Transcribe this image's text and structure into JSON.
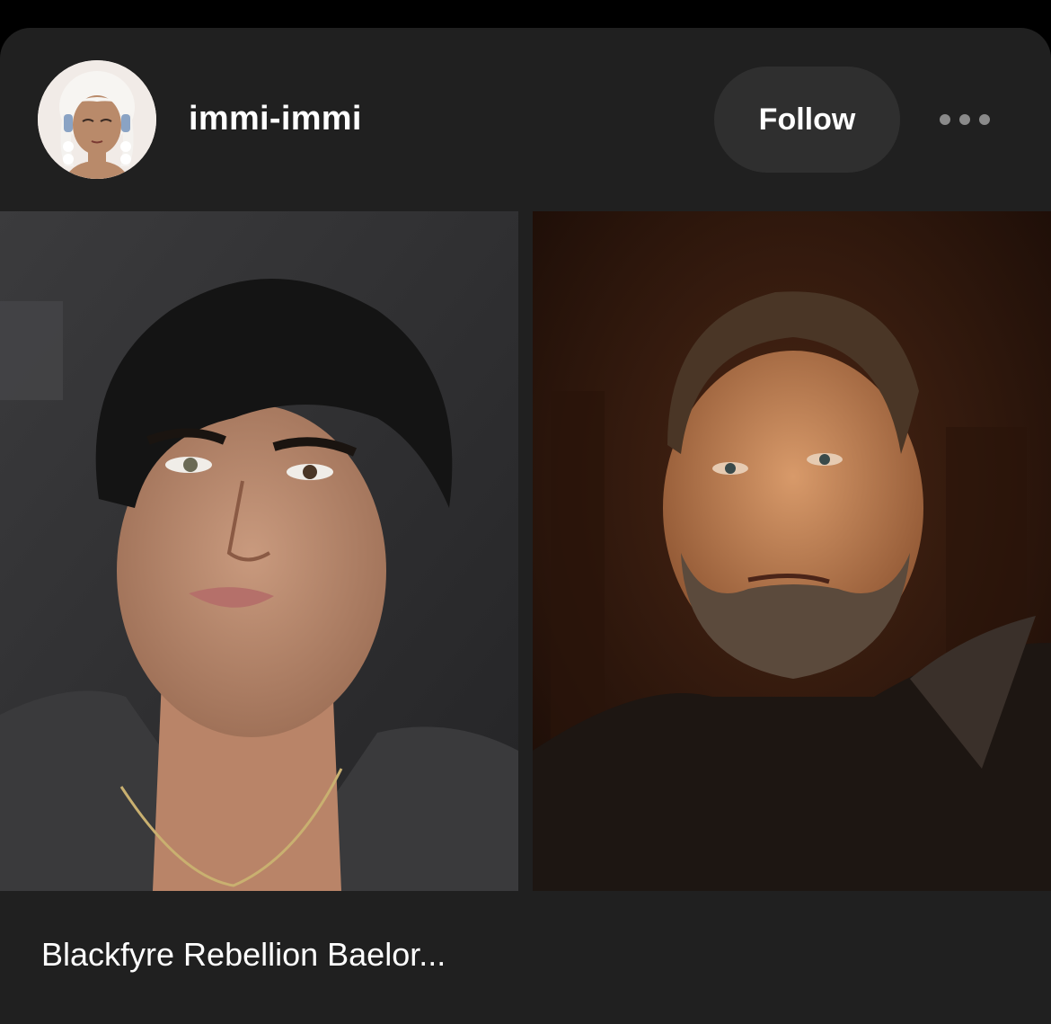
{
  "post": {
    "username": "immi-immi",
    "follow_label": "Follow",
    "caption": "Blackfyre Rebellion Baelor..."
  },
  "images": [
    {
      "name": "left-photo",
      "description": "portrait"
    },
    {
      "name": "right-photo",
      "description": "portrait"
    }
  ],
  "icons": {
    "more": "more-horizontal-icon",
    "avatar": "avatar-image"
  },
  "colors": {
    "background": "#000000",
    "card": "#202020",
    "button": "#2f2f2f",
    "text": "#ffffff",
    "dots": "#8a8a8a"
  }
}
